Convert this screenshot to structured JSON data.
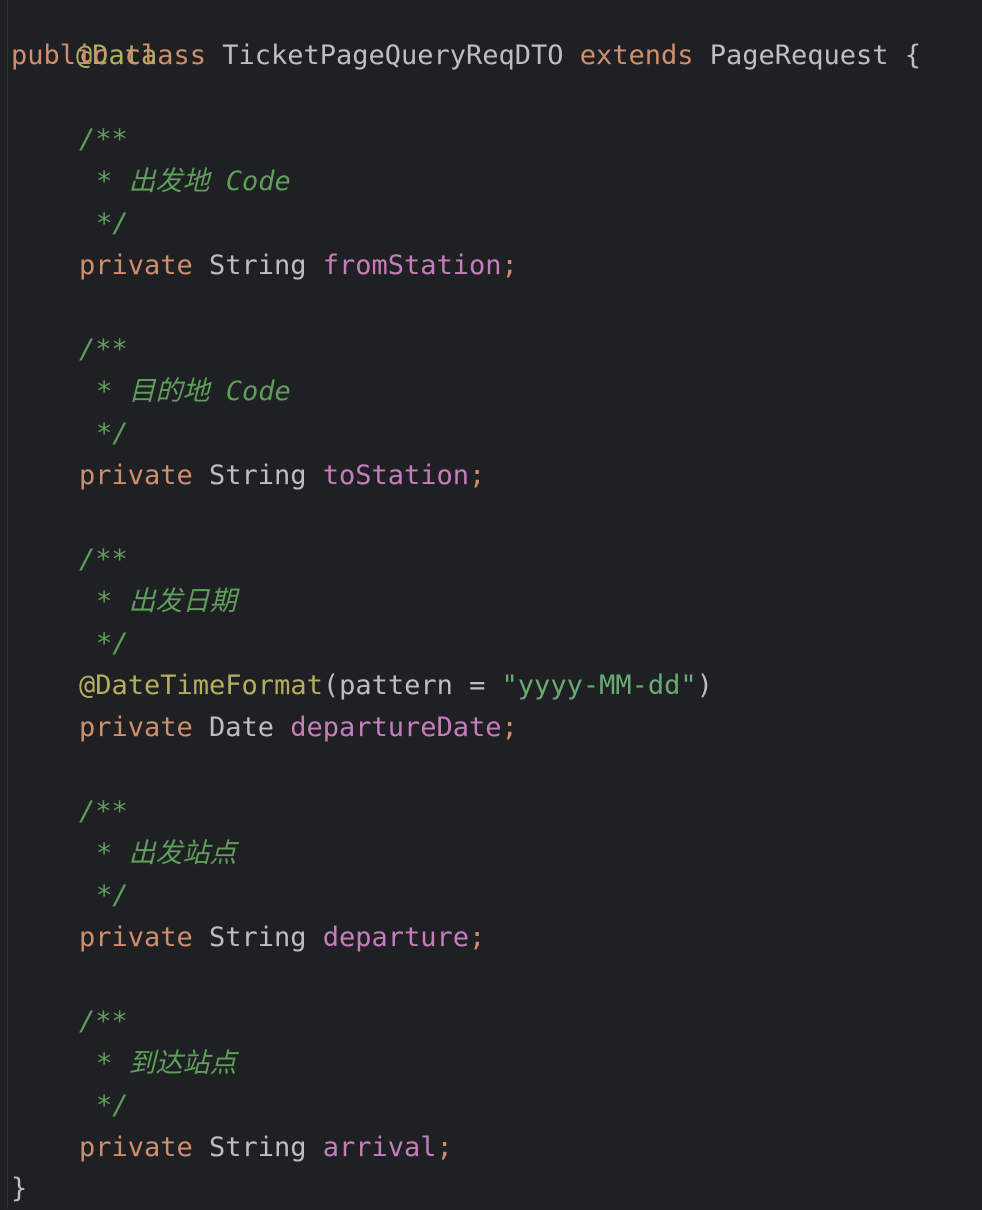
{
  "code": {
    "class_annotation": "@Data",
    "class_decl": {
      "kw_public": "public",
      "kw_class": "class",
      "class_name": "TicketPageQueryReqDTO",
      "kw_extends": "extends",
      "parent": "PageRequest",
      "brace_open": "{"
    },
    "doc_open": "/**",
    "doc_close": "*/",
    "doc_star": "*",
    "fields": [
      {
        "comment": "出发地 Code",
        "modifier": "private",
        "type": "String",
        "name": "fromStation",
        "semi": ";"
      },
      {
        "comment": "目的地 Code",
        "modifier": "private",
        "type": "String",
        "name": "toStation",
        "semi": ";"
      },
      {
        "comment": "出发日期",
        "annotation": {
          "name": "@DateTimeFormat",
          "open": "(",
          "param": "pattern",
          "eq": "=",
          "value": "\"yyyy-MM-dd\"",
          "close": ")"
        },
        "modifier": "private",
        "type": "Date",
        "name": "departureDate",
        "semi": ";"
      },
      {
        "comment": "出发站点",
        "modifier": "private",
        "type": "String",
        "name": "departure",
        "semi": ";"
      },
      {
        "comment": "到达站点",
        "modifier": "private",
        "type": "String",
        "name": "arrival",
        "semi": ";"
      }
    ],
    "brace_close": "}"
  }
}
